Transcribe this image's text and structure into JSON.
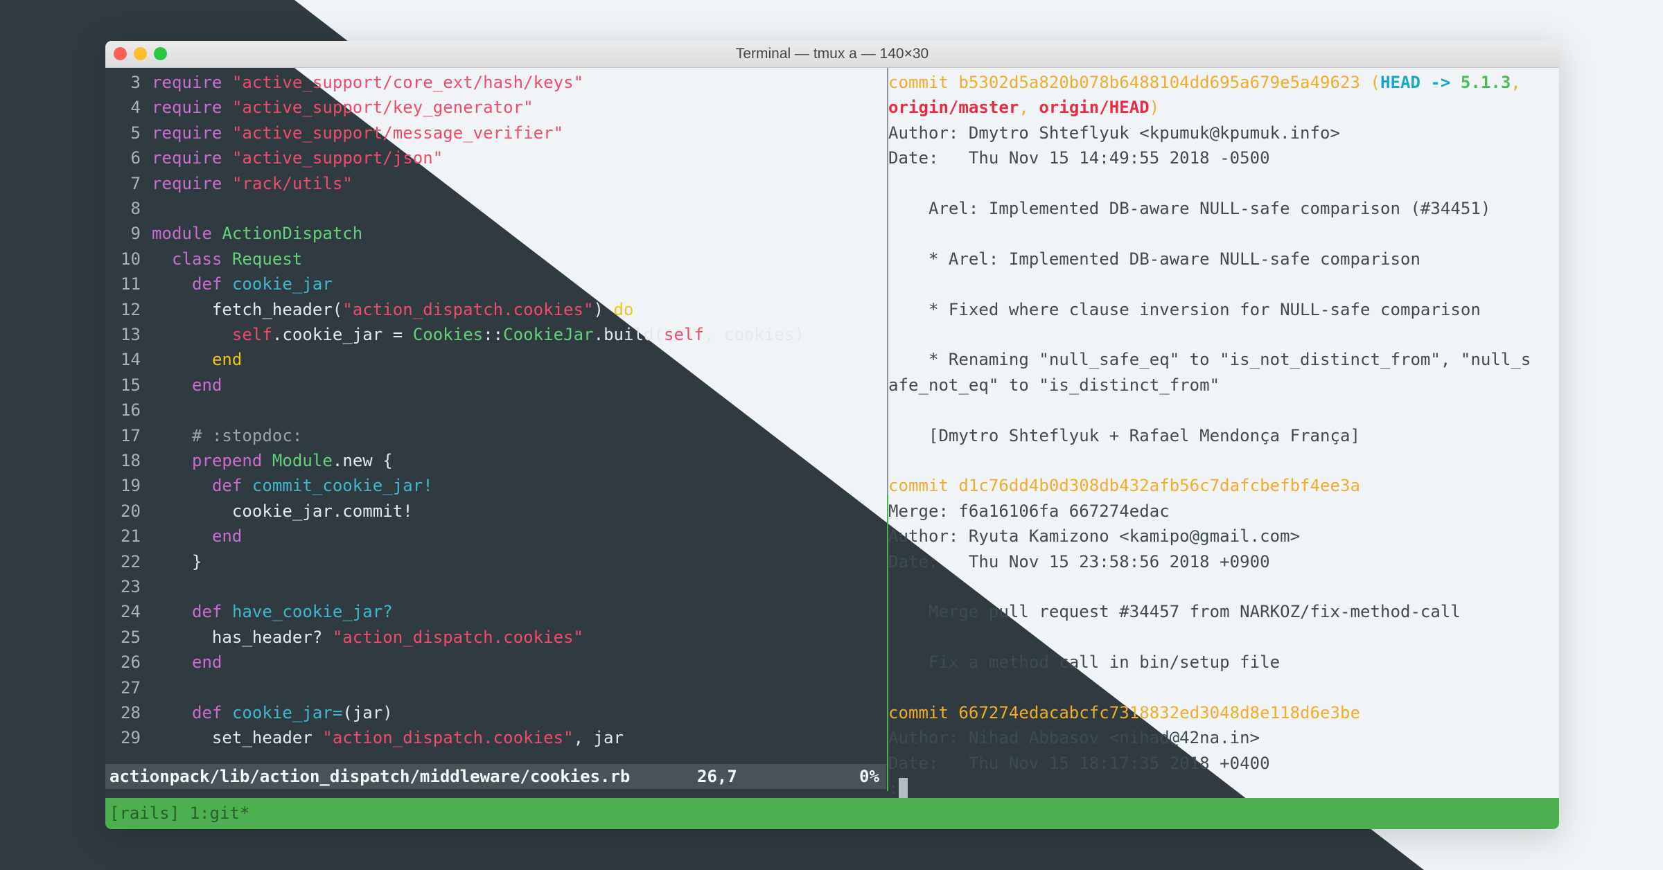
{
  "window": {
    "title": "Terminal — tmux a — 140×30"
  },
  "editor": {
    "lines": [
      {
        "n": "3",
        "tokens": [
          [
            "kw",
            "require"
          ],
          [
            "code",
            " "
          ],
          [
            "str",
            "\"active_support/core_ext/hash/keys\""
          ]
        ]
      },
      {
        "n": "4",
        "tokens": [
          [
            "kw",
            "require"
          ],
          [
            "code",
            " "
          ],
          [
            "str",
            "\"active_support/key_generator\""
          ]
        ]
      },
      {
        "n": "5",
        "tokens": [
          [
            "kw",
            "require"
          ],
          [
            "code",
            " "
          ],
          [
            "str",
            "\"active_support/message_verifier\""
          ]
        ]
      },
      {
        "n": "6",
        "tokens": [
          [
            "kw",
            "require"
          ],
          [
            "code",
            " "
          ],
          [
            "str",
            "\"active_support/json\""
          ]
        ]
      },
      {
        "n": "7",
        "tokens": [
          [
            "kw",
            "require"
          ],
          [
            "code",
            " "
          ],
          [
            "str",
            "\"rack/utils\""
          ]
        ]
      },
      {
        "n": "8",
        "tokens": []
      },
      {
        "n": "9",
        "tokens": [
          [
            "kw",
            "module"
          ],
          [
            "code",
            " "
          ],
          [
            "cn",
            "ActionDispatch"
          ]
        ]
      },
      {
        "n": "10",
        "tokens": [
          [
            "code",
            "  "
          ],
          [
            "kw",
            "class"
          ],
          [
            "code",
            " "
          ],
          [
            "cn",
            "Request"
          ]
        ]
      },
      {
        "n": "11",
        "tokens": [
          [
            "code",
            "    "
          ],
          [
            "kw",
            "def"
          ],
          [
            "code",
            " "
          ],
          [
            "fn",
            "cookie_jar"
          ]
        ]
      },
      {
        "n": "12",
        "tokens": [
          [
            "code",
            "      fetch_header("
          ],
          [
            "str",
            "\"action_dispatch.cookies\""
          ],
          [
            "code",
            ") "
          ],
          [
            "ye",
            "do"
          ]
        ]
      },
      {
        "n": "13",
        "tokens": [
          [
            "code",
            "        "
          ],
          [
            "str",
            "self"
          ],
          [
            "code",
            ".cookie_jar = "
          ],
          [
            "cn",
            "Cookies"
          ],
          [
            "code",
            "::"
          ],
          [
            "cn",
            "CookieJar"
          ],
          [
            "code",
            ".build("
          ],
          [
            "str",
            "self"
          ],
          [
            "code",
            ", cookies)"
          ]
        ]
      },
      {
        "n": "14",
        "tokens": [
          [
            "code",
            "      "
          ],
          [
            "ye",
            "end"
          ]
        ]
      },
      {
        "n": "15",
        "tokens": [
          [
            "code",
            "    "
          ],
          [
            "kw",
            "end"
          ]
        ]
      },
      {
        "n": "16",
        "tokens": []
      },
      {
        "n": "17",
        "tokens": [
          [
            "code",
            "    "
          ],
          [
            "cm",
            "# :stopdoc:"
          ]
        ]
      },
      {
        "n": "18",
        "tokens": [
          [
            "code",
            "    "
          ],
          [
            "kw",
            "prepend"
          ],
          [
            "code",
            " "
          ],
          [
            "cn",
            "Module"
          ],
          [
            "code",
            ".new {"
          ]
        ]
      },
      {
        "n": "19",
        "tokens": [
          [
            "code",
            "      "
          ],
          [
            "kw",
            "def"
          ],
          [
            "code",
            " "
          ],
          [
            "fn",
            "commit_cookie_jar!"
          ]
        ]
      },
      {
        "n": "20",
        "tokens": [
          [
            "code",
            "        cookie_jar.commit!"
          ]
        ]
      },
      {
        "n": "21",
        "tokens": [
          [
            "code",
            "      "
          ],
          [
            "kw",
            "end"
          ]
        ]
      },
      {
        "n": "22",
        "tokens": [
          [
            "code",
            "    }"
          ]
        ]
      },
      {
        "n": "23",
        "tokens": []
      },
      {
        "n": "24",
        "tokens": [
          [
            "code",
            "    "
          ],
          [
            "kw",
            "def"
          ],
          [
            "code",
            " "
          ],
          [
            "fn",
            "have_cookie_jar?"
          ]
        ]
      },
      {
        "n": "25",
        "tokens": [
          [
            "code",
            "      has_header? "
          ],
          [
            "str",
            "\"action_dispatch.cookies\""
          ]
        ]
      },
      {
        "n": "26",
        "tokens": [
          [
            "code",
            "    "
          ],
          [
            "kw",
            "end"
          ]
        ]
      },
      {
        "n": "27",
        "tokens": []
      },
      {
        "n": "28",
        "tokens": [
          [
            "code",
            "    "
          ],
          [
            "kw",
            "def"
          ],
          [
            "code",
            " "
          ],
          [
            "fn",
            "cookie_jar="
          ],
          [
            "code",
            "(jar)"
          ]
        ]
      },
      {
        "n": "29",
        "tokens": [
          [
            "code",
            "      set_header "
          ],
          [
            "str",
            "\"action_dispatch.cookies\""
          ],
          [
            "code",
            ", jar"
          ]
        ]
      }
    ],
    "status": {
      "path": "actionpack/lib/action_dispatch/middleware/cookies.rb",
      "position": "26,7",
      "percent": "0%"
    }
  },
  "git_log": {
    "lines": [
      {
        "g": "|",
        "gc": "hash",
        "tokens": [
          [
            "hash",
            "commit b5302d5a820b078b6488104dd695a679e5a49623 ("
          ],
          [
            "cyan",
            "HEAD -> "
          ],
          [
            "grb",
            "5.1.3"
          ],
          [
            "hash",
            ", "
          ]
        ]
      },
      {
        "g": "|",
        "gc": "gutter",
        "tokens": [
          [
            "redb",
            "origin/master"
          ],
          [
            "hash",
            ", "
          ],
          [
            "redb",
            "origin/HEAD"
          ],
          [
            "hash",
            ")"
          ]
        ]
      },
      {
        "g": "|",
        "gc": "gutter",
        "tokens": [
          [
            "right",
            "Author: Dmytro Shteflyuk <kpumuk@kpumuk.info>"
          ]
        ]
      },
      {
        "g": "|",
        "gc": "gutter",
        "tokens": [
          [
            "right",
            "Date:   Thu Nov 15 14:49:55 2018 -0500"
          ]
        ]
      },
      {
        "g": "|",
        "gc": "gutter",
        "tokens": []
      },
      {
        "g": "|",
        "gc": "gutter",
        "tokens": [
          [
            "right",
            "    Arel: Implemented DB-aware NULL-safe comparison (#34451)"
          ]
        ]
      },
      {
        "g": "|",
        "gc": "gutter",
        "tokens": []
      },
      {
        "g": "|",
        "gc": "gutter",
        "tokens": [
          [
            "right",
            "    * Arel: Implemented DB-aware NULL-safe comparison"
          ]
        ]
      },
      {
        "g": "|",
        "gc": "gutter",
        "tokens": []
      },
      {
        "g": "|",
        "gc": "gutter",
        "tokens": [
          [
            "right",
            "    * Fixed where clause inversion for NULL-safe comparison"
          ]
        ]
      },
      {
        "g": "|",
        "gc": "gutter",
        "tokens": []
      },
      {
        "g": "|",
        "gc": "gutter",
        "tokens": [
          [
            "right",
            "    * Renaming \"null_safe_eq\" to \"is_not_distinct_from\", \"null_s"
          ]
        ]
      },
      {
        "g": "",
        "gc": "gutter",
        "tokens": [
          [
            "right",
            "afe_not_eq\" to \"is_distinct_from\""
          ]
        ]
      },
      {
        "g": "|",
        "gc": "gutter",
        "tokens": []
      },
      {
        "g": "|",
        "gc": "gutter",
        "tokens": [
          [
            "right",
            "    [Dmytro Shteflyuk + Rafael Mendonça França]"
          ]
        ]
      },
      {
        "g": "|",
        "gc": "gutter",
        "tokens": []
      },
      {
        "g": "",
        "gc": "gutter",
        "tokens": [
          [
            "hash",
            "commit d1c76dd4b0d308db432afb56c7dafcbefbf4ee3a"
          ]
        ]
      },
      {
        "g": "|",
        "gc": "gutter",
        "tokens": [
          [
            "right",
            "Merge: f6a16106fa 667274edac"
          ]
        ]
      },
      {
        "g": "|",
        "gc": "gutter",
        "tokens": [
          [
            "right",
            "Author: Ryuta Kamizono <kamipo@gmail.com>"
          ]
        ]
      },
      {
        "g": "|",
        "gc": "gutter",
        "tokens": [
          [
            "right",
            "Date:   Thu Nov 15 23:58:56 2018 +0900"
          ]
        ]
      },
      {
        "g": "|",
        "gc": "gutter",
        "tokens": []
      },
      {
        "g": "|",
        "gc": "gutter",
        "tokens": [
          [
            "right",
            "    Merge pull request #34457 from NARKOZ/fix-method-call"
          ]
        ]
      },
      {
        "g": "|",
        "gc": "gutter",
        "tokens": []
      },
      {
        "g": "|",
        "gc": "gutter",
        "tokens": [
          [
            "right",
            "    Fix a method call in bin/setup file"
          ]
        ]
      },
      {
        "g": "|",
        "gc": "gutter",
        "tokens": []
      },
      {
        "g": "|",
        "gc": "gutter",
        "tokens": [
          [
            "hash",
            "commit 667274edacabcfc7318832ed3048d8e118d6e3be"
          ]
        ]
      },
      {
        "g": "|",
        "gc": "gutter",
        "tokens": [
          [
            "right",
            "Author: Nihad Abbasov <nihad@42na.in>"
          ]
        ]
      },
      {
        "g": "|",
        "gc": "gutter",
        "tokens": [
          [
            "right",
            "Date:   Thu Nov 15 18:17:35 2018 +0400"
          ]
        ]
      }
    ],
    "prompt": ":"
  },
  "tmux": {
    "status": "[rails] 1:git*"
  },
  "colors": {
    "dark_bg": "#2f3b41",
    "light_bg": "#f1f4f6",
    "tmux_green": "#4caf50",
    "status_bar": "#485359"
  }
}
